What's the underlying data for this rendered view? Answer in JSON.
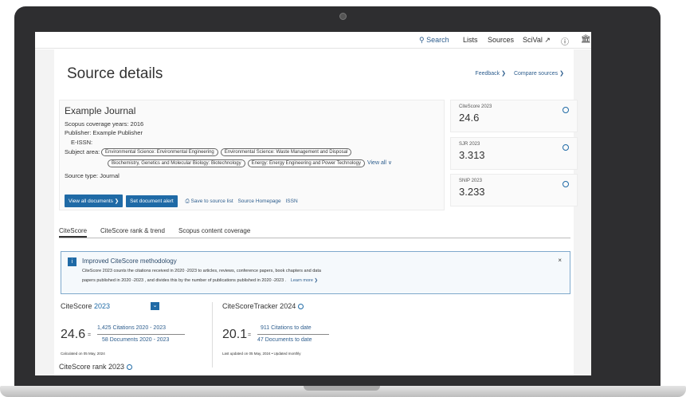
{
  "nav": {
    "search": "Search",
    "lists": "Lists",
    "sources": "Sources",
    "scival": "SciVal ↗"
  },
  "page": {
    "title": "Source details",
    "feedback": "Feedback ❯",
    "compare": "Compare sources ❯"
  },
  "journal": {
    "name": "Example Journal",
    "coverage": "Scopus coverage years:  2016",
    "publisher": "Publisher: Example Publisher",
    "eissn": "E-ISSN:",
    "subject_label": "Subject area:",
    "subjects_row1": [
      "Environmental Science: Environmental Engineering",
      "Environmental Science: Waste Management and Disposal"
    ],
    "subjects_row2": [
      "Biochemistry, Genetics and Molecular Biology: Biotechnology",
      "Energy: Energy Engineering and Power Technology"
    ],
    "view_all": "View all ∨",
    "source_type": "Source type:  Journal"
  },
  "actions": {
    "view_docs": "View all documents ❯",
    "set_alert": "Set document alert",
    "save_list": "Save to source list",
    "homepage": "Source Homepage",
    "issn": "ISSN"
  },
  "metrics": [
    {
      "label": "CiteScore 2023",
      "value": "24.6"
    },
    {
      "label": "SJR 2023",
      "value": "3.313"
    },
    {
      "label": "SNIP 2023",
      "value": "3.233"
    }
  ],
  "tabs": [
    "CiteScore",
    "CiteScore rank & trend",
    "Scopus content coverage"
  ],
  "notice": {
    "badge": "i",
    "title": "Improved CiteScore methodology",
    "line1": "CiteScore 2023  counts the citations received in 2020 -2023  to articles, reviews, conference papers, book chapters and data",
    "line2": "papers published in 2020 -2023 , and divides this by the number of publications published in 2020 -2023 .",
    "learn_more": "Learn more ❯",
    "close": "×"
  },
  "citescore": {
    "label": "CiteScore",
    "year": "2023",
    "value": "24.6",
    "equals": "=",
    "numerator": "1,425 Citations 2020 - 2023",
    "denominator": "58 Documents 2020 - 2023",
    "calculated": "Calculated on 05 May, 2024"
  },
  "tracker": {
    "label": "CiteScoreTracker 2024",
    "value": "20.1",
    "equals": "=",
    "numerator": "911 Citations to date",
    "denominator": "47 Documents to date",
    "updated": "Last updated on 05 May, 2024 • Updated monthly"
  },
  "rank": {
    "label": "CiteScore rank 2023"
  }
}
